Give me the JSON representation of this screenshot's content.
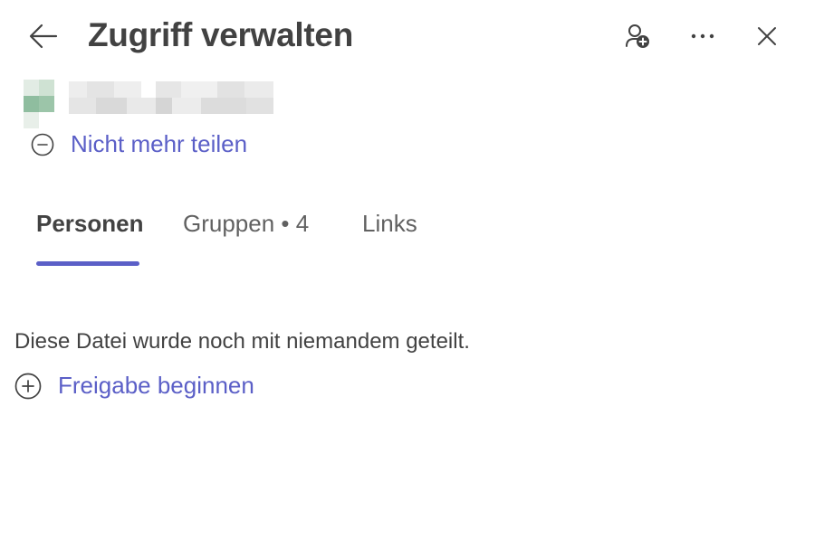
{
  "header": {
    "title": "Zugriff verwalten",
    "icons": {
      "back": "arrow-left-icon",
      "add_people": "person-add-icon",
      "more": "more-horizontal-icon",
      "close": "close-icon"
    }
  },
  "file": {
    "name_obscured": true,
    "thumbnail_colors": [
      "#c5dcca",
      "#8fbd9f",
      "#dde9df"
    ]
  },
  "actions": {
    "stop_sharing_label": "Nicht mehr teilen",
    "start_sharing_label": "Freigabe beginnen"
  },
  "tabs": [
    {
      "label": "Personen",
      "active": true
    },
    {
      "label": "Gruppen • 4",
      "active": false
    },
    {
      "label": "Links",
      "active": false
    }
  ],
  "content": {
    "empty_message": "Diese Datei wurde noch mit niemandem geteilt."
  },
  "colors": {
    "accent": "#5b5fc7",
    "text": "#424242"
  }
}
